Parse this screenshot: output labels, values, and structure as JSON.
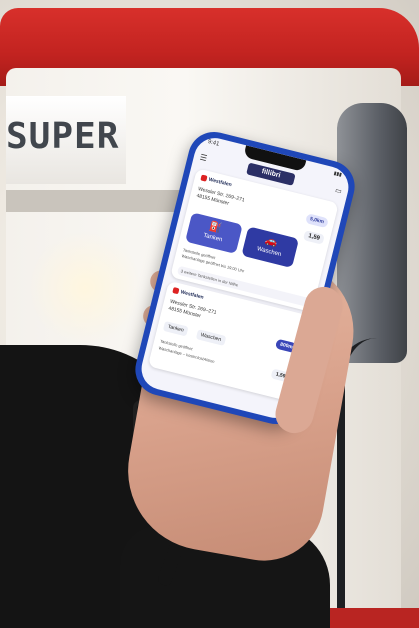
{
  "background": {
    "pump_sign": "SUPER",
    "pump_red": "#c22320"
  },
  "phone": {
    "status": {
      "time": "9:41",
      "signal": "▮▮▮"
    },
    "app": {
      "logo": "fillibri",
      "cards": [
        {
          "brand": "Westfalen",
          "address_line1": "Wessler Str. 269–271",
          "address_line2": "48155 Münster",
          "distance": "5,0km",
          "price": "1,59",
          "buttons": [
            "Tanken",
            "Waschen"
          ],
          "tag1": "Tankstelle geöffnet",
          "tag2": "Waschanlage geöffnet bis 19:00 Uhr",
          "more": "3 weitere Tankstellen in der Nähe"
        },
        {
          "brand": "Westfalen",
          "address_line1": "Wessler Str. 269–271",
          "address_line2": "48155 Münster",
          "distance": "800m",
          "price": "1,59",
          "buttons": [
            "Tanken",
            "Waschen"
          ],
          "tag1": "Tankstelle geöffnet",
          "tag2": "Waschanlage – kostenlos/Aktion"
        }
      ]
    },
    "accent": "#1f47b8"
  }
}
